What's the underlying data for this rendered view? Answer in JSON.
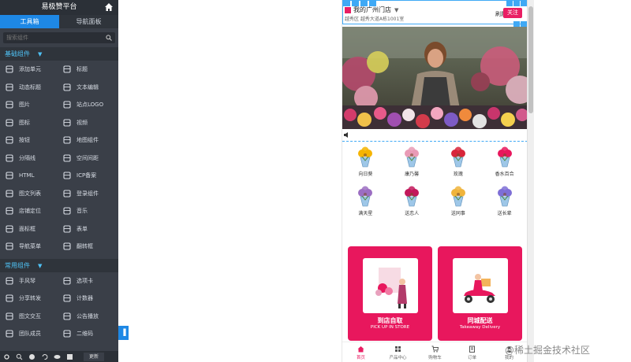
{
  "sidebar": {
    "title": "易极赞平台",
    "tabs": [
      {
        "label": "工具箱",
        "active": true
      },
      {
        "label": "导航面板",
        "active": false
      }
    ],
    "search_placeholder": "搜索组件",
    "basic_group": "基础组件",
    "basic_items": [
      {
        "label": "添加单元",
        "icon": "layout-icon"
      },
      {
        "label": "标题",
        "icon": "text-t-icon"
      },
      {
        "label": "动态标题",
        "icon": "dynamic-title-icon"
      },
      {
        "label": "文本编辑",
        "icon": "text-edit-icon"
      },
      {
        "label": "图片",
        "icon": "image-icon"
      },
      {
        "label": "站点LOGO",
        "icon": "logo-icon"
      },
      {
        "label": "图标",
        "icon": "icon-icon"
      },
      {
        "label": "视频",
        "icon": "video-icon"
      },
      {
        "label": "按钮",
        "icon": "button-icon"
      },
      {
        "label": "地图组件",
        "icon": "map-pin-icon"
      },
      {
        "label": "分隔线",
        "icon": "divider-icon"
      },
      {
        "label": "空间间距",
        "icon": "spacing-icon"
      },
      {
        "label": "HTML",
        "icon": "code-icon"
      },
      {
        "label": "ICP备案",
        "icon": "icp-icon"
      },
      {
        "label": "图文列表",
        "icon": "list-icon"
      },
      {
        "label": "登录组件",
        "icon": "login-icon"
      },
      {
        "label": "店铺定位",
        "icon": "store-locate-icon"
      },
      {
        "label": "音乐",
        "icon": "music-icon"
      },
      {
        "label": "面标框",
        "icon": "frame-icon"
      },
      {
        "label": "表单",
        "icon": "form-icon"
      },
      {
        "label": "导航菜单",
        "icon": "nav-menu-icon"
      },
      {
        "label": "翻转框",
        "icon": "flip-icon"
      }
    ],
    "common_group": "常用组件",
    "common_items": [
      {
        "label": "手风琴",
        "icon": "accordion-icon"
      },
      {
        "label": "选项卡",
        "icon": "tab-card-icon"
      },
      {
        "label": "分享转发",
        "icon": "share-icon"
      },
      {
        "label": "计数器",
        "icon": "counter-icon"
      },
      {
        "label": "图文交互",
        "icon": "interaction-icon"
      },
      {
        "label": "公告播放",
        "icon": "notice-icon"
      },
      {
        "label": "团队成员",
        "icon": "team-icon"
      },
      {
        "label": "二维码",
        "icon": "qrcode-icon"
      }
    ],
    "footer_button": "更新"
  },
  "phone": {
    "store_name": "我的广州门店",
    "address": "越秀区 越秀大道A栋1001室",
    "nav_link": "刷题",
    "follow_button": "关注",
    "categories": [
      {
        "label": "向日葵",
        "color": "#f5b400"
      },
      {
        "label": "康乃馨",
        "color": "#e99bb6"
      },
      {
        "label": "玫瑰",
        "color": "#d8263a"
      },
      {
        "label": "香水百合",
        "color": "#e8175d"
      },
      {
        "label": "满天星",
        "color": "#9c6ec2"
      },
      {
        "label": "送恋人",
        "color": "#c2185b"
      },
      {
        "label": "送同事",
        "color": "#f0b43c"
      },
      {
        "label": "送长辈",
        "color": "#7e6fd6"
      }
    ],
    "cards": [
      {
        "title": "到店自取",
        "subtitle": "PICK UP IN STORE"
      },
      {
        "title": "同城配送",
        "subtitle": "Takeaway Delivery"
      }
    ],
    "tabbar": [
      {
        "label": "首页",
        "icon": "home-icon",
        "active": true
      },
      {
        "label": "产品中心",
        "icon": "grid-icon",
        "active": false
      },
      {
        "label": "购物车",
        "icon": "cart-icon",
        "active": false
      },
      {
        "label": "订单",
        "icon": "order-icon",
        "active": false
      },
      {
        "label": "我的",
        "icon": "user-icon",
        "active": false
      }
    ]
  },
  "watermark": "@稀土掘金技术社区",
  "colors": {
    "accent": "#1e88e5",
    "brand": "#e8175d",
    "sidebar": "#3a3f48"
  }
}
